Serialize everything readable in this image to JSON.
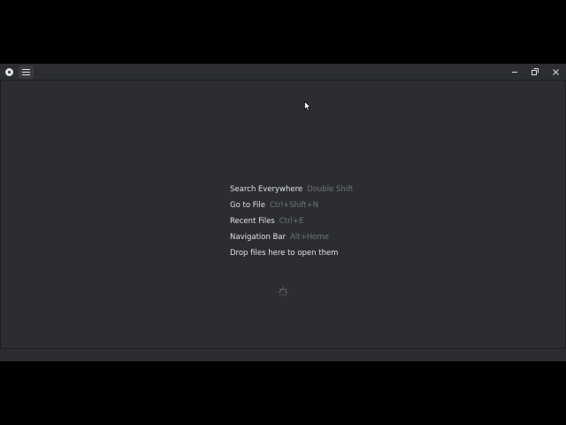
{
  "window": {
    "app_icon": "app-logo-icon",
    "menu_icon": "hamburger-menu-icon",
    "controls": {
      "minimize_icon": "minimize-icon",
      "restore_icon": "restore-icon",
      "close_icon": "close-icon"
    }
  },
  "welcome_hints": [
    {
      "action": "Search Everywhere",
      "shortcut": "Double Shift"
    },
    {
      "action": "Go to File",
      "shortcut": "Ctrl+Shift+N"
    },
    {
      "action": "Recent Files",
      "shortcut": "Ctrl+E"
    },
    {
      "action": "Navigation Bar",
      "shortcut": "Alt+Home"
    },
    {
      "action": "Drop files here to open them",
      "shortcut": ""
    }
  ],
  "colors": {
    "background": "#2b2d30",
    "text_primary": "#dfe1e5",
    "text_secondary": "#6f737a",
    "border": "#1e1f22"
  }
}
